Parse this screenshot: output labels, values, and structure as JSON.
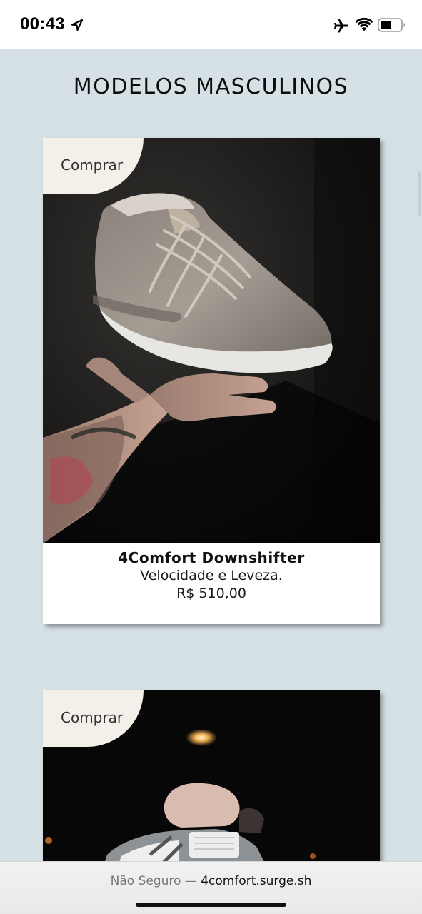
{
  "status_bar": {
    "time": "00:43",
    "icons": [
      "location-arrow-icon",
      "airplane-icon",
      "wifi-icon",
      "battery-icon"
    ]
  },
  "page": {
    "title": "MODELOS MASCULINOS"
  },
  "products": [
    {
      "buy_label": "Comprar",
      "name": "4Comfort Downshifter",
      "tagline": "Velocidade e Leveza.",
      "price": "R$ 510,00"
    },
    {
      "buy_label": "Comprar"
    }
  ],
  "browser_bar": {
    "security_label": "Não Seguro — ",
    "domain": "4comfort.surge.sh"
  },
  "colors": {
    "page_background": "#d6e1e6",
    "button_background": "#f3f0ea",
    "card_background": "#ffffff"
  }
}
